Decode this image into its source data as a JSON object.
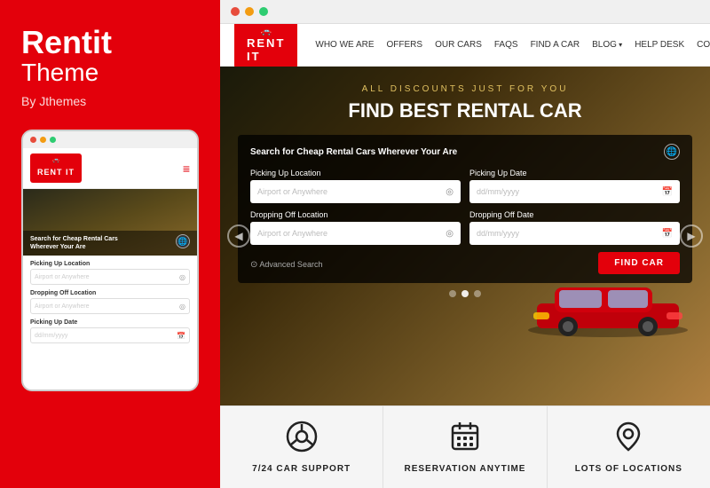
{
  "left": {
    "brand_title": "Rentit",
    "brand_subtitle": "Theme",
    "by_line": "By Jthemes",
    "mobile": {
      "dots": [
        "#e74c3c",
        "#f39c12",
        "#2ecc71"
      ],
      "logo_car": "🚗",
      "logo_text": "RENT IT",
      "hamburger": "≡",
      "hero_text": "Search for Cheap Rental Cars\nWherever Your Are",
      "form": {
        "label1": "Picking Up Location",
        "placeholder1": "Airport or Anywhere",
        "label2": "Dropping Off Location",
        "placeholder2": "Airport or Anywhere",
        "label3": "Picking Up Date",
        "placeholder3": "dd/mm/yyyy"
      }
    }
  },
  "browser": {
    "dots": [
      "#e74c3c",
      "#f39c12",
      "#2ecc71"
    ]
  },
  "nav": {
    "logo_car": "🚗",
    "logo_text": "RENT IT",
    "links": [
      "WHO WE ARE",
      "OFFERS",
      "OUR CARS",
      "FAQS",
      "FIND A CAR",
      "BLOG",
      "HELP DESK",
      "CONTACT"
    ]
  },
  "hero": {
    "tagline": "ALL DISCOUNTS JUST FOR YOU",
    "title": "FIND BEST RENTAL CAR",
    "search_title": "Search for Cheap Rental Cars Wherever Your Are",
    "form": {
      "label_pickup_loc": "Picking Up Location",
      "placeholder_pickup_loc": "Airport or Anywhere",
      "label_pickup_date": "Picking Up Date",
      "placeholder_pickup_date": "dd/mm/yyyy",
      "label_dropoff_loc": "Dropping Off Location",
      "placeholder_dropoff_loc": "Airport or Anywhere",
      "label_dropoff_date": "Dropping Off Date",
      "placeholder_dropoff_date": "dd/mm/yyyy",
      "find_car_btn": "FIND CAR",
      "advanced_search": "Advanced Search"
    },
    "dots": [
      false,
      true,
      false
    ],
    "arrows": [
      "◀",
      "▶"
    ]
  },
  "features": [
    {
      "icon": "⊕",
      "label": "7/24 CAR SUPPORT"
    },
    {
      "icon": "📅",
      "label": "RESERVATION ANYTIME"
    },
    {
      "icon": "📍",
      "label": "LOTS OF LOCATIONS"
    }
  ]
}
